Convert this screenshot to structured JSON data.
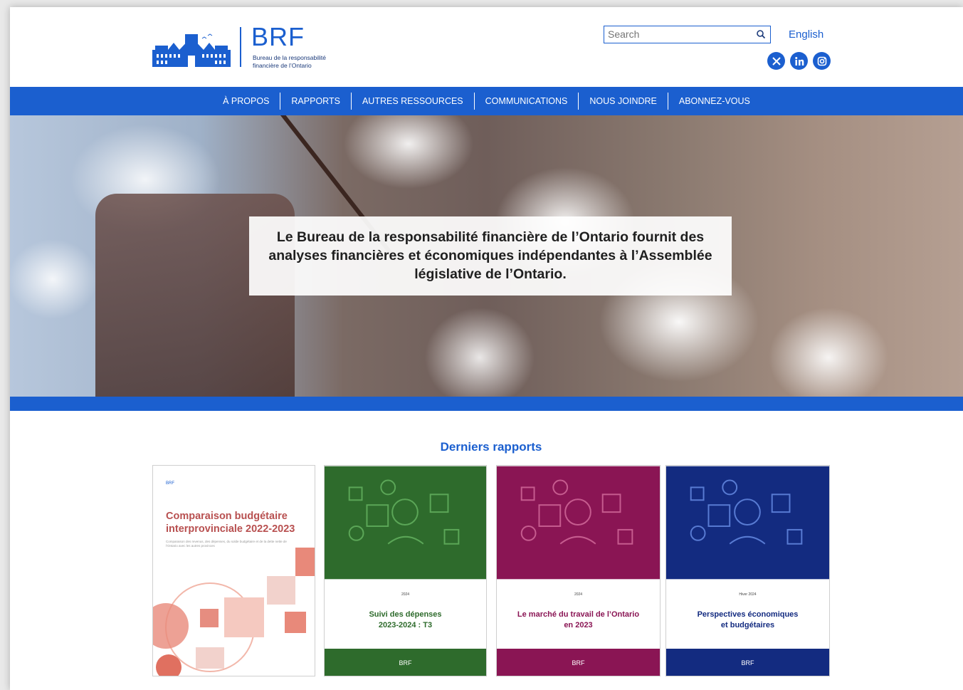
{
  "header": {
    "logo_text": "BRF",
    "logo_subtitle_line1": "Bureau de la responsabilité",
    "logo_subtitle_line2": "financière de l’Ontario",
    "search_placeholder": "Search",
    "language_link": "English",
    "social": [
      "x-icon",
      "linkedin-icon",
      "instagram-icon"
    ]
  },
  "nav": {
    "items": [
      "À PROPOS",
      "RAPPORTS",
      "AUTRES RESSOURCES",
      "COMMUNICATIONS",
      "NOUS JOINDRE",
      "ABONNEZ-VOUS"
    ]
  },
  "hero": {
    "caption": "Le Bureau de la responsabilité financière de l’Ontario fournit des analyses financières et économiques indépendantes à l’Assemblée législative de l’Ontario."
  },
  "reports": {
    "section_title": "Derniers rapports",
    "cards": [
      {
        "title_line1": "Comparaison budgétaire",
        "title_line2": "interprovinciale 2022-2023",
        "subtitle": "Comparaison des revenus, des dépenses, du solde budgétaire et de la dette nette de l’Ontario avec les autres provinces"
      },
      {
        "year": "2024",
        "title_line1": "Suivi des dépenses",
        "title_line2": "2023-2024 : T3",
        "color": "#2e6b2c"
      },
      {
        "year": "2024",
        "title_line1": "Le marché du travail de l’Ontario",
        "title_line2": "en 2023",
        "color": "#8a1554"
      },
      {
        "year": "Hiver 2024",
        "title_line1": "Perspectives économiques",
        "title_line2": "et budgétaires",
        "color": "#132b80"
      }
    ],
    "mini_logo": "BRF"
  }
}
